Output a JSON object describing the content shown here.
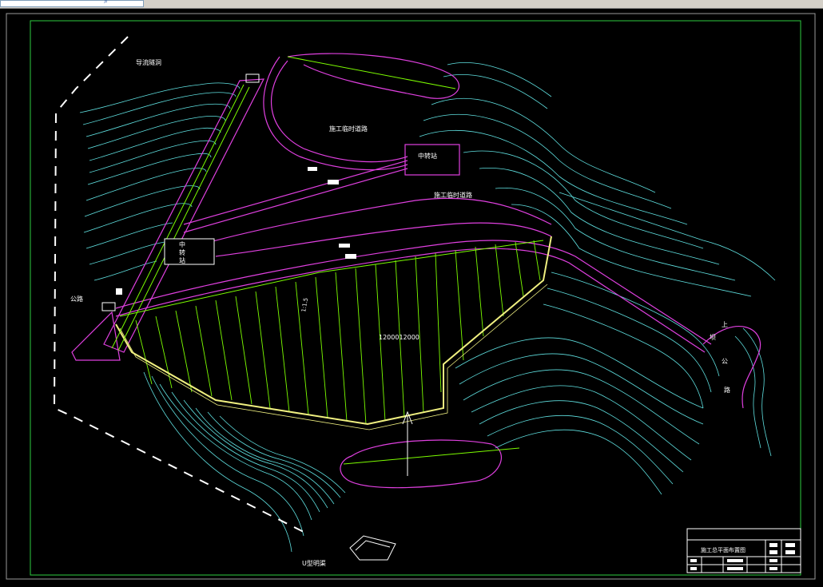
{
  "toolbar": {
    "search_icon": "search-icon"
  },
  "drawing": {
    "labels": {
      "diversion_tunnel": "导流隧洞",
      "road_left": "公路",
      "temp_road_1": "施工临时道路",
      "temp_road_2": "施工临时道路",
      "transfer_station_top": "中转站",
      "transfer_station_left_1": "中",
      "transfer_station_left_2": "转",
      "transfer_station_left_3": "站",
      "upper_dam_road_1": "上",
      "upper_dam_road_2": "坝",
      "upper_dam_road_3": "公",
      "upper_dam_road_4": "路",
      "slope": "1:1.5",
      "dam_crest": "1200012000",
      "u_shaped": "U型明渠"
    },
    "title_block": {
      "title": "施工总平面布置图"
    },
    "colors": {
      "background": "#000000",
      "frame": "#2ecc40",
      "contour": "#5fe0e0",
      "road": "#e040e0",
      "dam_hatch": "#7cfc00",
      "dam_edge": "#f0f080",
      "white": "#ffffff"
    }
  }
}
